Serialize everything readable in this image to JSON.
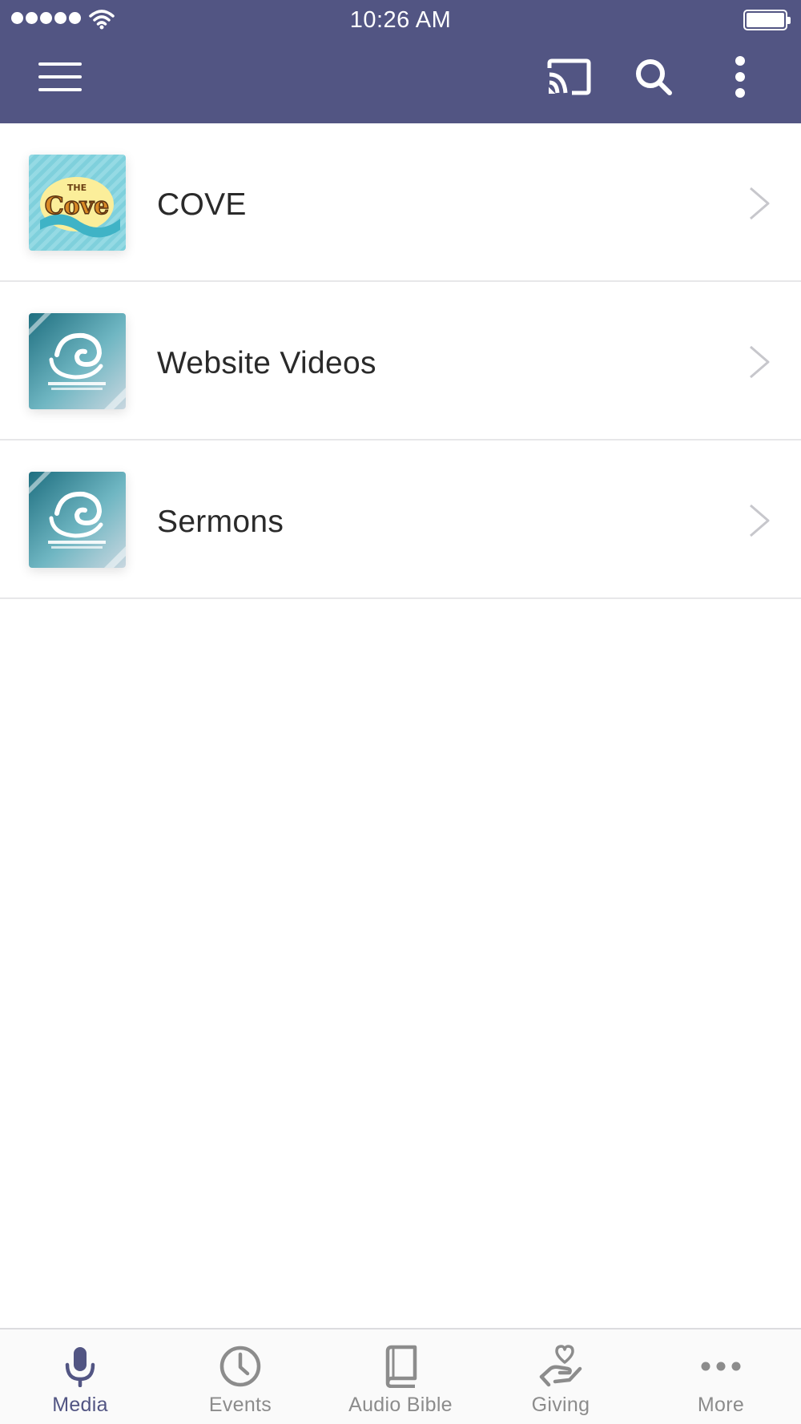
{
  "status_bar": {
    "time": "10:26 AM"
  },
  "toolbar": {
    "menu_icon": "hamburger-menu-icon",
    "cast_icon": "cast-icon",
    "search_icon": "search-icon",
    "more_icon": "vertical-ellipsis-icon"
  },
  "colors": {
    "header_bg": "#525583",
    "accent": "#525583",
    "tab_inactive": "#8c8c8c",
    "divider": "#e7e7e9"
  },
  "media_list": [
    {
      "label": "COVE",
      "thumbnail": "the-cove-logo"
    },
    {
      "label": "Website Videos",
      "thumbnail": "coastline-wave-logo"
    },
    {
      "label": "Sermons",
      "thumbnail": "coastline-wave-logo"
    }
  ],
  "tabs": [
    {
      "label": "Media",
      "icon": "microphone-icon",
      "active": true
    },
    {
      "label": "Events",
      "icon": "clock-icon",
      "active": false
    },
    {
      "label": "Audio Bible",
      "icon": "book-icon",
      "active": false
    },
    {
      "label": "Giving",
      "icon": "heart-hand-icon",
      "active": false
    },
    {
      "label": "More",
      "icon": "horizontal-ellipsis-icon",
      "active": false
    }
  ]
}
